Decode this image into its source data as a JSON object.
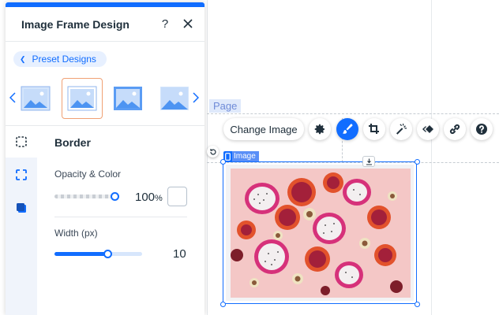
{
  "canvas": {
    "page_label": "Page",
    "element_tag": "Image"
  },
  "toolbar": {
    "change_image_label": "Change Image",
    "tools": [
      {
        "name": "settings",
        "icon": "gear-icon"
      },
      {
        "name": "design",
        "icon": "paintbrush-icon",
        "active": true
      },
      {
        "name": "crop",
        "icon": "crop-icon"
      },
      {
        "name": "filters",
        "icon": "magic-wand-icon"
      },
      {
        "name": "animation",
        "icon": "animation-icon"
      },
      {
        "name": "link",
        "icon": "link-icon"
      },
      {
        "name": "help",
        "icon": "help-icon"
      }
    ]
  },
  "panel": {
    "title": "Image Frame Design",
    "help_label": "?",
    "preset_link": "Preset Designs",
    "presets_selected_index": 1,
    "tabs": [
      {
        "name": "border",
        "icon": "border-dashed-icon",
        "active": true
      },
      {
        "name": "corners",
        "icon": "corners-icon"
      },
      {
        "name": "shadow",
        "icon": "shadow-icon"
      }
    ],
    "section_title": "Border",
    "opacity": {
      "label": "Opacity & Color",
      "value": "100",
      "unit": "%",
      "fraction": 1.0,
      "color": "#ffffff"
    },
    "width": {
      "label": "Width (px)",
      "value": "10",
      "fraction": 0.6
    }
  },
  "colors": {
    "accent": "#116dff",
    "selected_thumb": "#f0a174",
    "tab_strip": "#f0f4fb",
    "photo_background": "#f4c7c6"
  }
}
